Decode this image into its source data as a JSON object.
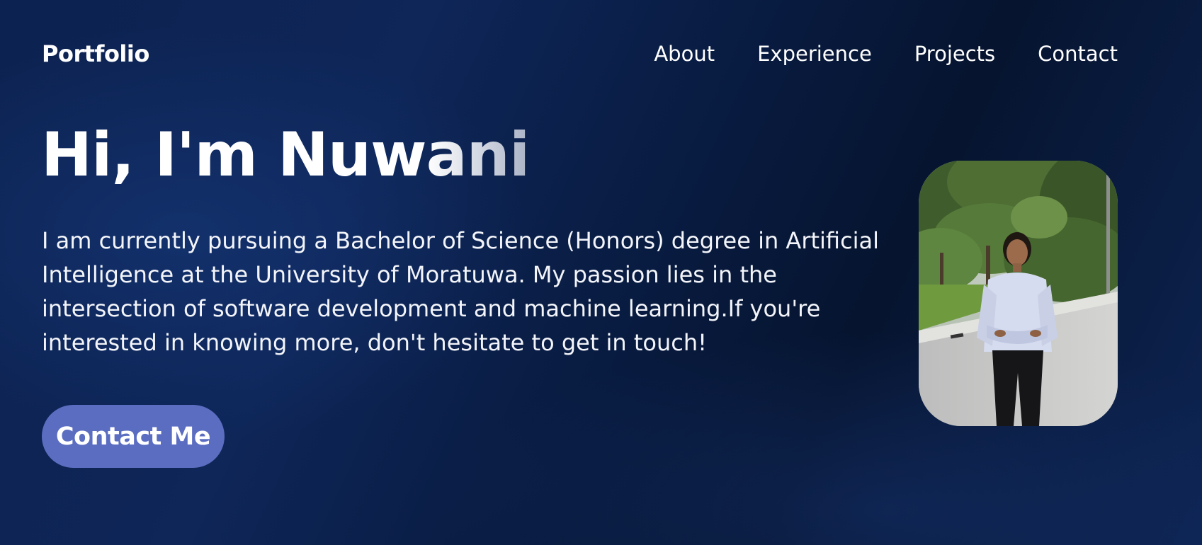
{
  "header": {
    "brand": "Portfolio",
    "nav": [
      {
        "label": "About"
      },
      {
        "label": "Experience"
      },
      {
        "label": "Projects"
      },
      {
        "label": "Contact"
      }
    ]
  },
  "hero": {
    "title_start": "Hi, I'm Nuw",
    "title_end": "ani",
    "description": "I am currently pursuing a Bachelor of Science (Honors) degree in Artificial Intelligence at the University of Moratuwa. My passion lies in the intersection of software development and machine learning.If you're interested in knowing more, don't hesitate to get in touch!",
    "cta_label": "Contact Me"
  },
  "colors": {
    "background": "#0b2150",
    "button": "#5b6dc1",
    "text": "#ffffff"
  }
}
